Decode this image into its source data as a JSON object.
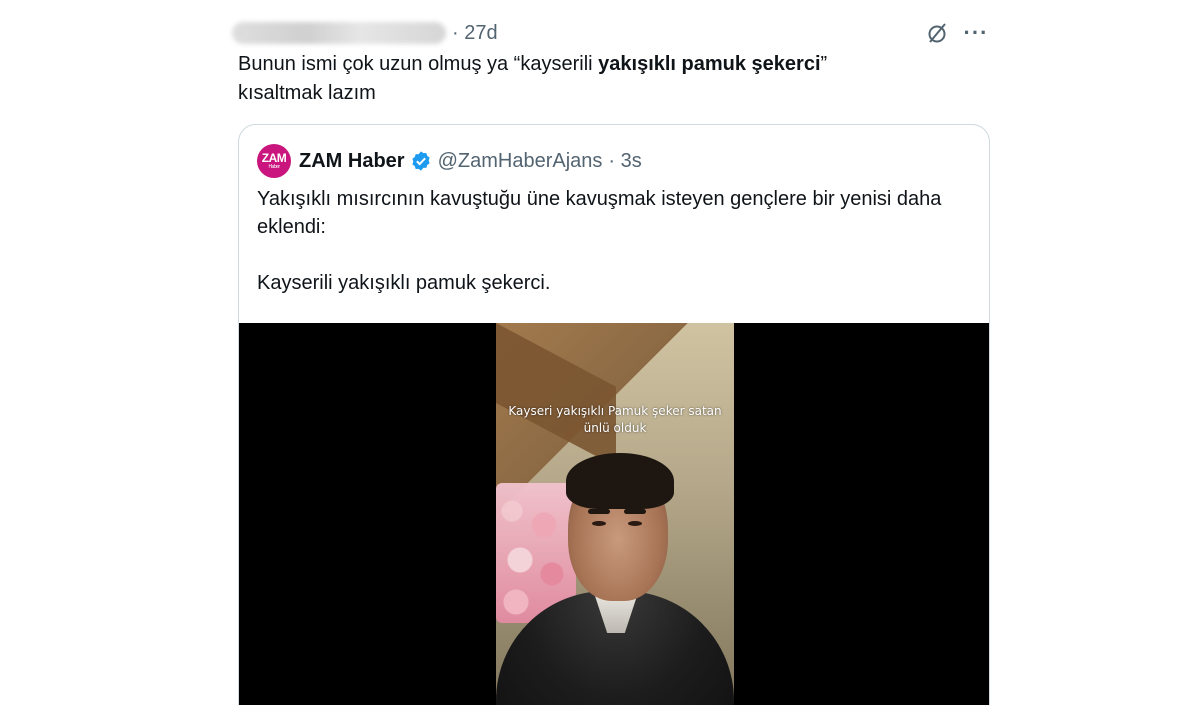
{
  "tweet": {
    "author_blurred": true,
    "time": "· 27d",
    "text_before_bold": "Bunun ismi çok uzun olmuş ya “kayserili ",
    "text_bold": "yakışıklı pamuk şekerci",
    "text_after_bold": "”",
    "text_line2": "kısaltmak lazım",
    "more_label": "···"
  },
  "quote": {
    "avatar_text": "ZAM",
    "avatar_sub": "Haber",
    "name": "ZAM Haber",
    "handle": "@ZamHaberAjans",
    "time": "· 3s",
    "body_line1": "Yakışıklı mısırcının kavuştuğu üne kavuşmak isteyen gençlere bir yenisi daha eklendi:",
    "body_line2": "Kayserili yakışıklı pamuk şekerci.",
    "video_caption_line1": "Kayseri yakışıklı Pamuk şeker satan",
    "video_caption_line2": "ünlü olduk"
  },
  "colors": {
    "avatar_bg": "#c9157d",
    "verified": "#1d9bf0",
    "muted_text": "#536471",
    "border": "#cfd9de"
  },
  "icons": [
    "grok-icon",
    "more-icon",
    "verified-badge-icon"
  ]
}
